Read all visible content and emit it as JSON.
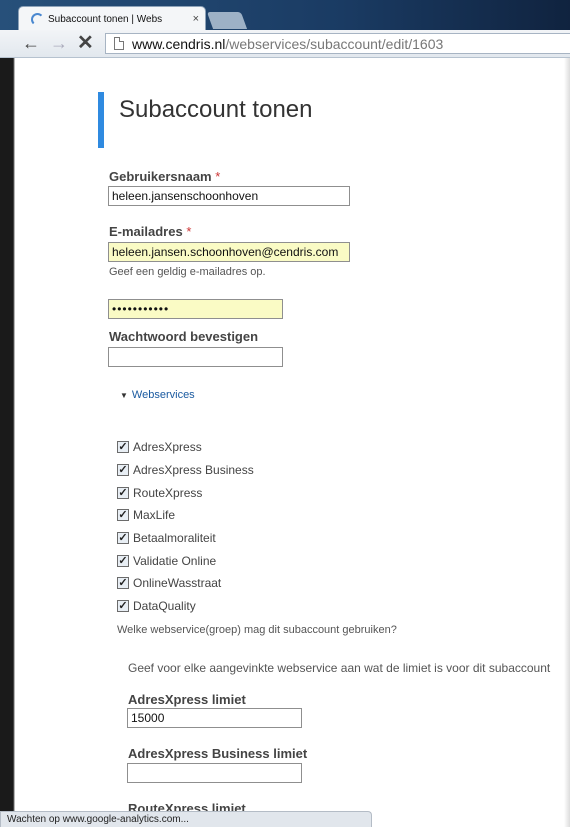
{
  "browser": {
    "tab_title": "Subaccount tonen | Webs",
    "tab_close": "×",
    "url_host": "www.cendris.nl",
    "url_path": "/webservices/subaccount/edit/1603",
    "status_text": "Wachten op www.google-analytics.com..."
  },
  "page": {
    "title": "Subaccount tonen",
    "required_marker": "*",
    "username_label": "Gebruikersnaam",
    "username_value": "heleen.jansenschoonhoven",
    "email_label": "E-mailadres",
    "email_value": "heleen.jansen.schoonhoven@cendris.com",
    "email_help": "Geef een geldig e-mailadres op.",
    "password_value": "•••••••••••",
    "confirm_label": "Wachtwoord bevestigen",
    "confirm_value": "",
    "webservices_toggle": "Webservices",
    "services": [
      {
        "label": "AdresXpress",
        "checked": true
      },
      {
        "label": "AdresXpress Business",
        "checked": true
      },
      {
        "label": "RouteXpress",
        "checked": true
      },
      {
        "label": "MaxLife",
        "checked": true
      },
      {
        "label": "Betaalmoraliteit",
        "checked": true
      },
      {
        "label": "Validatie Online",
        "checked": true
      },
      {
        "label": "OnlineWasstraat",
        "checked": true
      },
      {
        "label": "DataQuality",
        "checked": true
      }
    ],
    "services_help": "Welke webservice(groep) mag dit subaccount gebruiken?",
    "limits_intro": "Geef voor elke aangevinkte webservice aan wat de limiet is voor dit subaccount",
    "limit1_label": "AdresXpress limiet",
    "limit1_value": "15000",
    "limit2_label": "AdresXpress Business limiet",
    "limit2_value": "",
    "limit3_label": "RouteXpress limiet"
  }
}
